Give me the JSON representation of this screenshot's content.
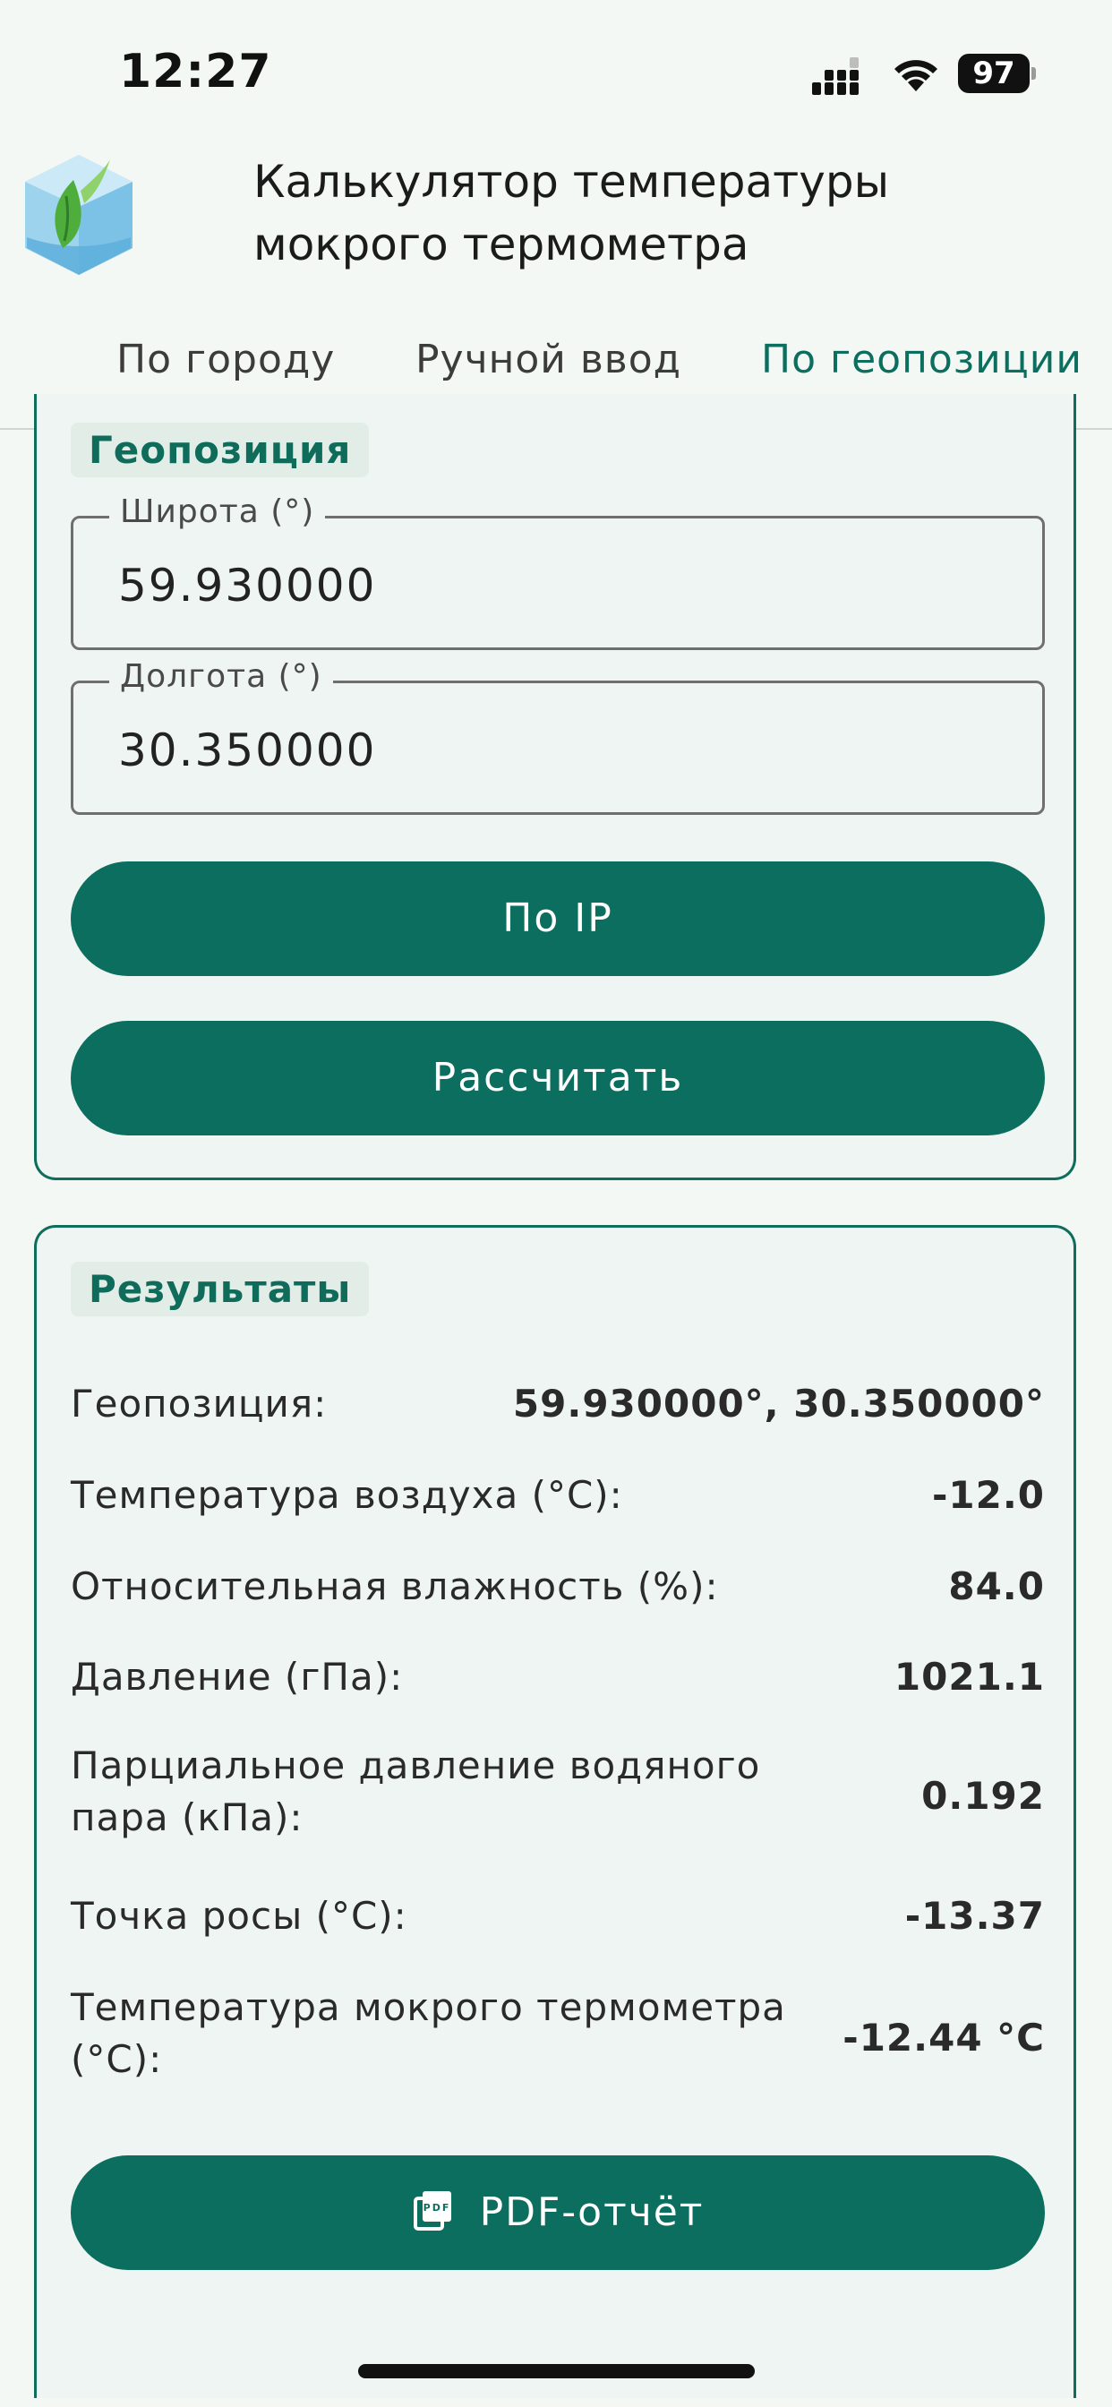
{
  "status_bar": {
    "time": "12:27",
    "battery": "97"
  },
  "header": {
    "title": "Калькулятор температуры мокрого термометра"
  },
  "tabs": [
    {
      "label": "По городу",
      "active": false
    },
    {
      "label": "Ручной ввод",
      "active": false
    },
    {
      "label": "По геопозиции",
      "active": true
    }
  ],
  "geo_card": {
    "title": "Геопозиция",
    "latitude": {
      "label": "Широта (°)",
      "value": "59.930000"
    },
    "longitude": {
      "label": "Долгота (°)",
      "value": "30.350000"
    },
    "by_ip_label": "По IP",
    "calculate_label": "Рассчитать"
  },
  "results": {
    "title": "Результаты",
    "rows": [
      {
        "label": "Геопозиция:",
        "value": "59.930000°, 30.350000°"
      },
      {
        "label": "Температура воздуха (°C):",
        "value": "-12.0"
      },
      {
        "label": "Относительная влажность (%):",
        "value": "84.0"
      },
      {
        "label": "Давление (гПа):",
        "value": "1021.1"
      },
      {
        "label": "Парциальное давление водяного пара (кПа):",
        "value": "0.192"
      },
      {
        "label": "Точка росы (°C):",
        "value": "-13.37"
      },
      {
        "label": "Температура мокрого термометра (°C):",
        "value": "-12.44 °C"
      }
    ],
    "pdf_label": "PDF-отчёт"
  },
  "colors": {
    "accent": "#0b6e5e",
    "background": "#f3f8f4",
    "card": "#eff5f2"
  },
  "icons": {
    "pdf": "pdf-file-icon",
    "logo": "app-logo-icon"
  }
}
